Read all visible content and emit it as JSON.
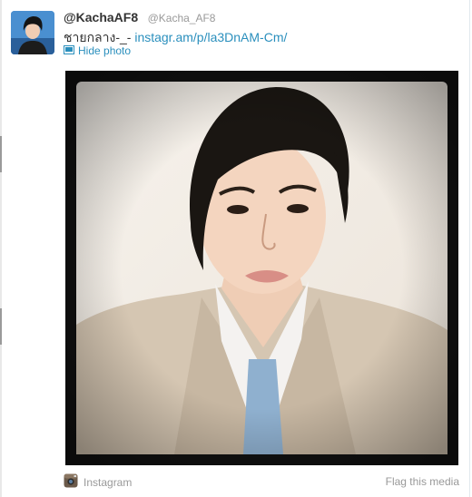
{
  "tweet": {
    "display_name": "@KachaAF8",
    "handle": "@Kacha_AF8",
    "text_prefix": "ชายกลาง-_- ",
    "link_text": "instagr.am/p/la3DnAM-Cm/",
    "hide_photo_label": "Hide photo"
  },
  "media": {
    "source_label": "Instagram",
    "flag_label": "Flag this media"
  },
  "icons": {
    "avatar": "profile-photo",
    "photo_toggle": "photo-icon",
    "source": "instagram-icon"
  },
  "colors": {
    "link": "#2a8fbd",
    "text": "#333333",
    "muted": "#999999"
  }
}
